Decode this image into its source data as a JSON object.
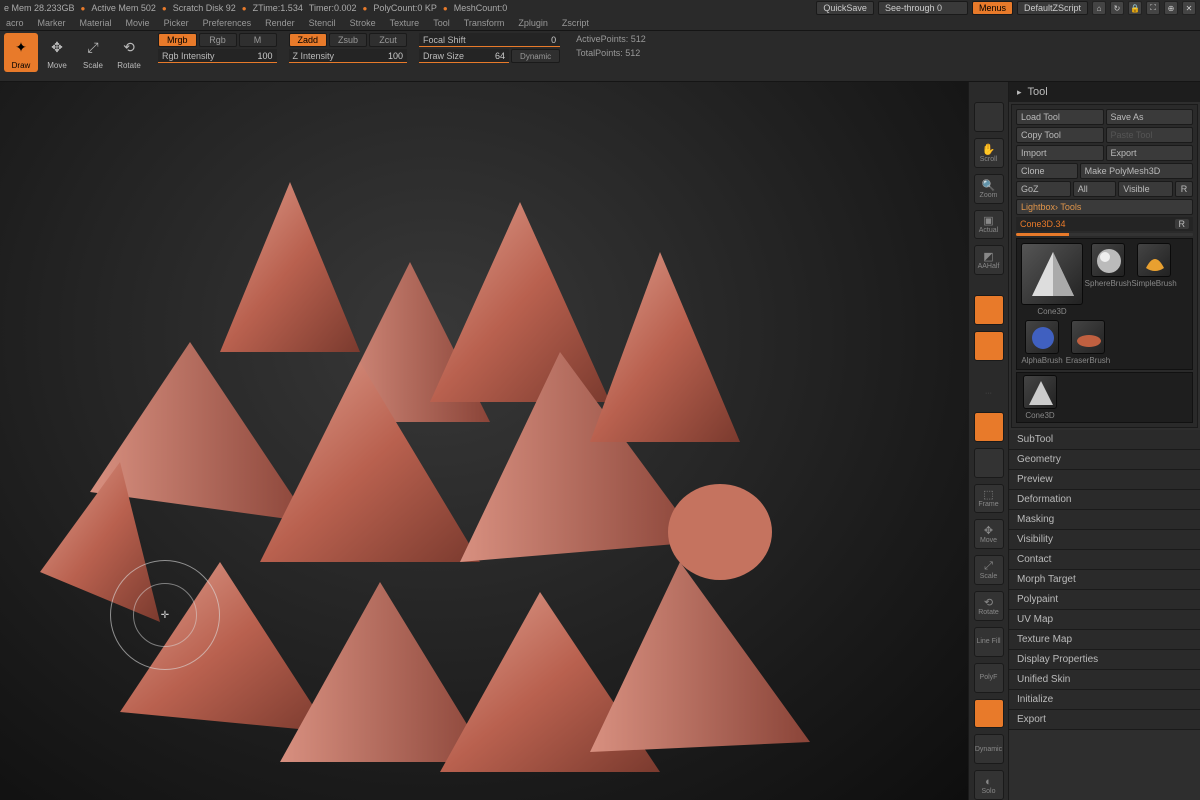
{
  "status": {
    "mem": "e Mem 28.233GB",
    "amem": "Active Mem 502",
    "scratch": "Scratch Disk 92",
    "ztime": "ZTime:1.534",
    "timer": "Timer:0.002",
    "poly": "PolyCount:0 KP",
    "mesh": "MeshCount:0",
    "quicksave": "QuickSave",
    "seethru": "See-through 0",
    "menus": "Menus",
    "defscript": "DefaultZScript"
  },
  "menu": [
    "acro",
    "Marker",
    "Material",
    "Movie",
    "Picker",
    "Preferences",
    "Render",
    "Stencil",
    "Stroke",
    "Texture",
    "Tool",
    "Transform",
    "Zplugin",
    "Zscript"
  ],
  "modes": {
    "draw": "Draw",
    "move": "Move",
    "scale": "Scale",
    "rotate": "Rotate"
  },
  "rgbopts": {
    "mrgb": "Mrgb",
    "rgb": "Rgb",
    "m": "M",
    "rgb_intensity_label": "Rgb Intensity",
    "rgb_intensity_val": "100"
  },
  "zopts": {
    "zadd": "Zadd",
    "zsub": "Zsub",
    "zcut": "Zcut",
    "z_intensity_label": "Z Intensity",
    "z_intensity_val": "100"
  },
  "brushopts": {
    "focal_label": "Focal Shift",
    "focal_val": "0",
    "draw_size_label": "Draw Size",
    "draw_size_val": "64",
    "dynamic": "Dynamic"
  },
  "points": {
    "active_label": "ActivePoints:",
    "active_val": "512",
    "total_label": "TotalPoints:",
    "total_val": "512"
  },
  "sidetools": [
    "",
    "Scroll",
    "Zoom",
    "Actual",
    "AAHalf",
    "",
    "",
    "",
    "",
    "",
    "Frame",
    "Move",
    "Scale",
    "Rotate",
    "Line Fill",
    "PolyF",
    "",
    "Dynamic",
    "Solo"
  ],
  "toolpanel": {
    "title": "Tool",
    "load": "Load Tool",
    "saveas": "Save As",
    "copy": "Copy Tool",
    "paste": "Paste Tool",
    "import": "Import",
    "export": "Export",
    "clone": "Clone",
    "makepoly": "Make PolyMesh3D",
    "goz": "GoZ",
    "all": "All",
    "visible": "Visible",
    "r": "R",
    "lightbox": "Lightbox› Tools",
    "toolname": "Cone3D.34",
    "r2": "R",
    "brushes": [
      {
        "name": "Cone3D",
        "kind": "cone"
      },
      {
        "name": "SphereBrush",
        "kind": "sphere"
      },
      {
        "name": "SimpleBrush",
        "kind": "simple"
      },
      {
        "name": "AlphaBrush",
        "kind": "alpha"
      },
      {
        "name": "",
        "kind": ""
      },
      {
        "name": "EraserBrush",
        "kind": "eraser"
      }
    ],
    "extra_thumb": "Cone3D",
    "sections": [
      "SubTool",
      "Geometry",
      "Preview",
      "Deformation",
      "Masking",
      "Visibility",
      "Contact",
      "Morph Target",
      "Polypaint",
      "UV Map",
      "Texture Map",
      "Display Properties",
      "Unified Skin",
      "Initialize",
      "Export"
    ]
  }
}
